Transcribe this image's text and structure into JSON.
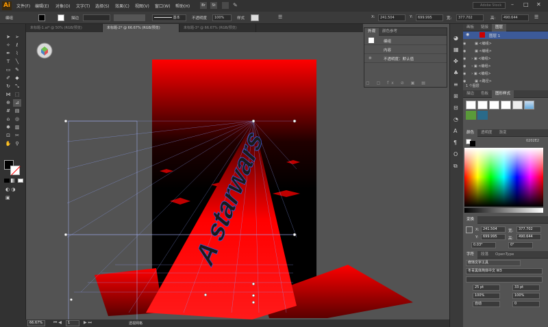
{
  "app": {
    "logo": "Ai",
    "search_placeholder": "Adobe Stock"
  },
  "menubar": {
    "items": [
      "文件(F)",
      "编辑(E)",
      "对象(O)",
      "文字(T)",
      "选择(S)",
      "效果(C)",
      "视图(V)",
      "窗口(W)",
      "帮助(H)"
    ],
    "badges": [
      "Br",
      "St"
    ]
  },
  "control_bar": {
    "label_mode": "编组",
    "stroke_label": "描边",
    "stroke_style": "基本",
    "opacity_label": "不透明度",
    "opacity_value": "100%",
    "style_label": "样式",
    "x_value": "241.504",
    "y_value": "699.995",
    "w_value": "377.702",
    "h_value": "490.644"
  },
  "tabs": [
    {
      "label": "未标题-1.ai* @ 50% (RGB/预览)",
      "active": false
    },
    {
      "label": "未标题-2* @ 66.67% (RGB/预览)",
      "active": true
    },
    {
      "label": "未标题-3* @ 66.67% (RGB/预览)",
      "active": false
    }
  ],
  "appearance_panel": {
    "tabs": [
      "外观",
      "颜色参考"
    ],
    "group_label": "编组",
    "content_label": "内容",
    "opacity_row": "不透明度：默认值"
  },
  "layers_panel": {
    "tabs": [
      "画板",
      "链接",
      "图层"
    ],
    "layer_name": "图层 1",
    "count_label": "1 个图层"
  },
  "graphic_styles_panel": {
    "tabs": [
      "描边",
      "色板",
      "图形样式"
    ]
  },
  "color_panel": {
    "tabs": [
      "颜色",
      "透明度",
      "渐变"
    ],
    "hex": "0202E2"
  },
  "transform_panel": {
    "tab": "变换",
    "x": "241.504",
    "y": "699.995",
    "w": "377.702",
    "h": "490.644",
    "angle": "0.03°",
    "shear": "0°",
    "x_label": "X:",
    "y_label": "Y:",
    "w_label": "宽:",
    "h_label": "高:"
  },
  "character_panel": {
    "tabs": [
      "字符",
      "段落",
      "OpenType"
    ],
    "tool": "修饰文字工具",
    "font": "冬青黑体简体中文 W3",
    "size": "25 pt",
    "leading": "33 pt",
    "scale_h": "100%",
    "scale_v": "100%",
    "tracking": "自动",
    "kerning": "0"
  },
  "status": {
    "zoom": "66.67%",
    "page": "1",
    "tool_name": "透视网格"
  },
  "artwork": {
    "text": "A starwars"
  },
  "colors": {
    "red": "#ff0000",
    "dark_red": "#8b0000",
    "blue": "#3a5ad8",
    "bg": "#535353"
  }
}
